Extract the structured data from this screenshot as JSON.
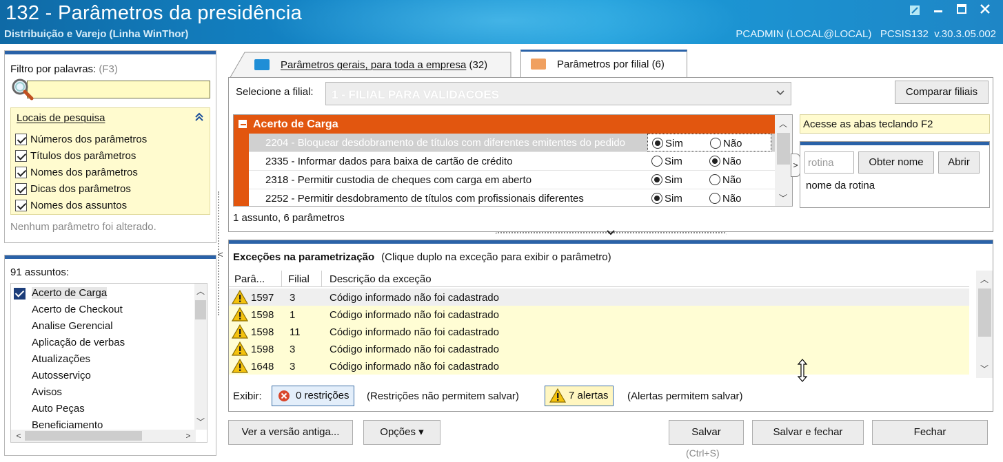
{
  "window": {
    "title": "132 - Parâmetros da presidência",
    "subtitle": "Distribuição e Varejo (Linha WinThor)",
    "user_info": "PCADMIN (LOCAL@LOCAL)   PCSIS132  v.30.3.05.002",
    "controls": [
      "restore-icon",
      "minimize-icon",
      "maximize-icon",
      "close-icon"
    ]
  },
  "filter": {
    "label": "Filtro por palavras:",
    "shortcut": "(F3)",
    "search_value": "",
    "locais_title": "Locais de pesquisa",
    "options": [
      {
        "label": "Números dos parâmetros",
        "checked": true
      },
      {
        "label": "Títulos dos parâmetros",
        "checked": true
      },
      {
        "label": "Nomes dos parâmetros",
        "checked": true
      },
      {
        "label": "Dicas dos parâmetros",
        "checked": true
      },
      {
        "label": "Nomes dos assuntos",
        "checked": true
      }
    ],
    "status": "Nenhum parâmetro foi alterado."
  },
  "subjects": {
    "count_label": "91 assuntos:",
    "items": [
      "Acerto de Carga",
      "Acerto de Checkout",
      "Analise Gerencial",
      "Aplicação de verbas",
      "Atualizações",
      "Autosserviço",
      "Avisos",
      "Auto Peças",
      "Beneficiamento"
    ],
    "selected": "Acerto de Carga"
  },
  "tabs": [
    {
      "label": "Parâmetros gerais, para toda a empresa",
      "count": "(32)",
      "active": false
    },
    {
      "label": "Parâmetros por filial",
      "count": "(6)",
      "active": true
    }
  ],
  "filial": {
    "label": "Selecione a filial:",
    "value": "1 - FILIAL PARA VALIDACOES",
    "compare_button": "Comparar filiais"
  },
  "params": {
    "group": "Acerto de Carga",
    "yes_label": "Sim",
    "no_label": "Não",
    "rows": [
      {
        "text": "2204 - Bloquear desdobramento de títulos com diferentes emitentes do pedido",
        "value": "Sim",
        "selected": true
      },
      {
        "text": "2335 - Informar dados para baixa de cartão de crédito",
        "value": "Não",
        "selected": false
      },
      {
        "text": "2318 - Permitir custodia de cheques com carga em aberto",
        "value": "Sim",
        "selected": false
      },
      {
        "text": "2252 - Permitir desdobramento de títulos com profissionais diferentes",
        "value": "Sim",
        "selected": false
      }
    ],
    "summary": "1 assunto, 6 parâmetros"
  },
  "side": {
    "hint": "Acesse as abas teclando F2",
    "rotina_placeholder": "rotina",
    "obter_button": "Obter nome",
    "abrir_button": "Abrir",
    "rotina_name": "nome da rotina"
  },
  "exceptions": {
    "title": "Exceções na parametrização",
    "subtitle": "(Clique duplo na exceção para exibir o parâmetro)",
    "headers": [
      "Parâ...",
      "Filial",
      "Descrição da exceção"
    ],
    "rows": [
      {
        "param": "1597",
        "filial": "3",
        "desc": "Código informado não foi cadastrado"
      },
      {
        "param": "1598",
        "filial": "1",
        "desc": "Código informado não foi cadastrado"
      },
      {
        "param": "1598",
        "filial": "11",
        "desc": "Código informado não foi cadastrado"
      },
      {
        "param": "1598",
        "filial": "3",
        "desc": "Código informado não foi cadastrado"
      },
      {
        "param": "1648",
        "filial": "3",
        "desc": "Código informado não foi cadastrado"
      }
    ],
    "footer": {
      "exibir_label": "Exibir:",
      "restricoes_button": "0 restrições",
      "restricoes_note": "(Restrições não permitem salvar)",
      "alertas_button": "7 alertas",
      "alertas_note": "(Alertas permitem salvar)"
    }
  },
  "buttons": {
    "old_version": "Ver a versão antiga...",
    "options": "Opções",
    "save": "Salvar",
    "save_shortcut": "(Ctrl+S)",
    "save_close": "Salvar e fechar",
    "close": "Fechar"
  },
  "colors": {
    "accent": "#2a62a8",
    "group_orange": "#e2560f",
    "highlight_yellow": "#fffbcf"
  }
}
